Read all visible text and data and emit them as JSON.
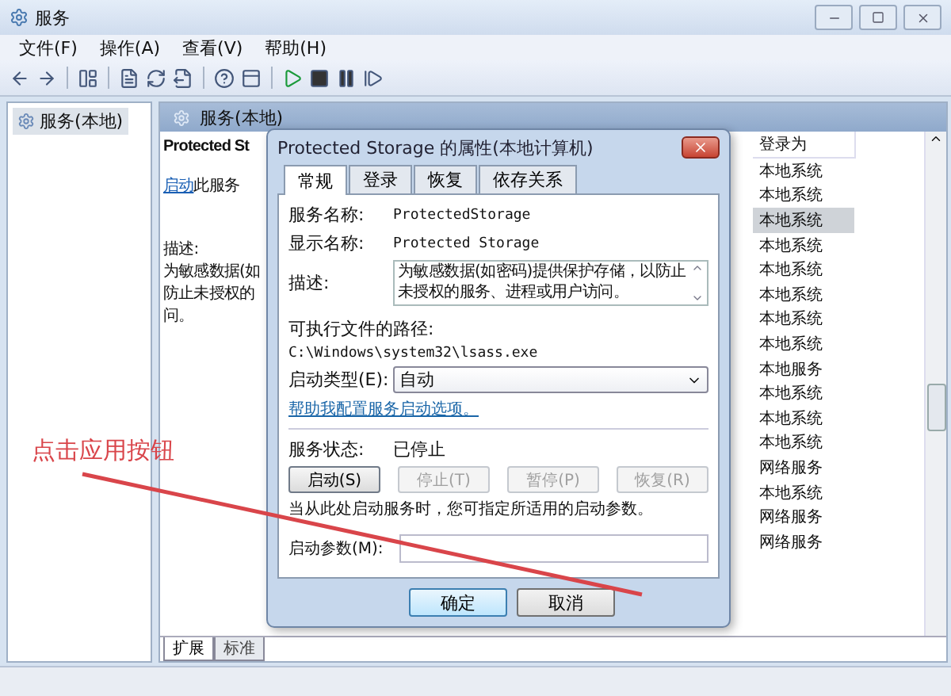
{
  "window": {
    "title": "服务"
  },
  "menu": [
    "文件(F)",
    "操作(A)",
    "查看(V)",
    "帮助(H)"
  ],
  "tree": {
    "items": [
      {
        "label": "服务(本地)",
        "selected": true
      }
    ]
  },
  "panel": {
    "header": "服务(本地)"
  },
  "detail": {
    "service_name": "Protected St",
    "start_link": "启动",
    "start_suffix": "此服务",
    "description_label": "描述:",
    "description_lines": [
      "为敏感数据(如",
      "防止未授权的",
      "问。"
    ]
  },
  "list": {
    "column": "登录为",
    "rows": [
      {
        "text": "本地系统",
        "selected": false
      },
      {
        "text": "本地系统",
        "selected": false
      },
      {
        "text": "本地系统",
        "selected": true
      },
      {
        "text": "本地系统",
        "selected": false
      },
      {
        "text": "本地系统",
        "selected": false
      },
      {
        "text": "本地系统",
        "selected": false
      },
      {
        "text": "本地系统",
        "selected": false
      },
      {
        "text": "本地系统",
        "selected": false
      },
      {
        "text": "本地服务",
        "selected": false
      },
      {
        "text": "本地系统",
        "selected": false
      },
      {
        "text": "本地系统",
        "selected": false
      },
      {
        "text": "本地系统",
        "selected": false
      },
      {
        "text": "网络服务",
        "selected": false
      },
      {
        "text": "本地系统",
        "selected": false
      },
      {
        "text": "网络服务",
        "selected": false
      },
      {
        "text": "网络服务",
        "selected": false
      }
    ]
  },
  "bottom_tabs": [
    {
      "label": "扩展",
      "selected": true
    },
    {
      "label": "标准",
      "selected": false
    }
  ],
  "dialog": {
    "title": "Protected Storage 的属性(本地计算机)",
    "tabs": [
      {
        "label": "常规",
        "selected": true
      },
      {
        "label": "登录",
        "selected": false
      },
      {
        "label": "恢复",
        "selected": false
      },
      {
        "label": "依存关系",
        "selected": false
      }
    ],
    "service_name_label": "服务名称:",
    "service_name": "ProtectedStorage",
    "display_name_label": "显示名称:",
    "display_name": "Protected Storage",
    "description_label": "描述:",
    "description": "为敏感数据(如密码)提供保护存储，以防止未授权的服务、进程或用户访问。",
    "path_label": "可执行文件的路径:",
    "path": "C:\\Windows\\system32\\lsass.exe",
    "startup_type_label": "启动类型(E):",
    "startup_type": "自动",
    "help_link": "帮助我配置服务启动选项。",
    "status_label": "服务状态:",
    "status": "已停止",
    "control_buttons": [
      {
        "label": "启动(S)",
        "disabled": false
      },
      {
        "label": "停止(T)",
        "disabled": true
      },
      {
        "label": "暂停(P)",
        "disabled": true
      },
      {
        "label": "恢复(R)",
        "disabled": true
      }
    ],
    "params_hint": "当从此处启动服务时，您可指定所适用的启动参数。",
    "params_label": "启动参数(M):",
    "buttons": [
      {
        "label": "确定",
        "default": true
      },
      {
        "label": "取消",
        "default": false
      }
    ]
  },
  "annotation": {
    "text": "点击应用按钮"
  }
}
